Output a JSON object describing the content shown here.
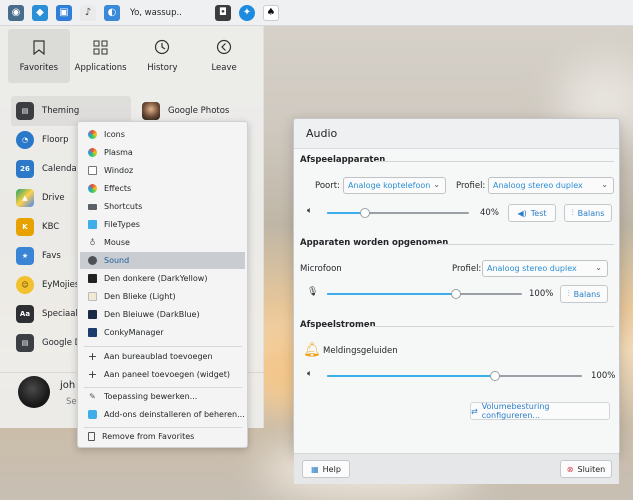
{
  "taskbar": {
    "window_title": "Yo, wassup.."
  },
  "launcher": {
    "tabs": [
      {
        "label": "Favorites",
        "icon": "bookmark-icon"
      },
      {
        "label": "Applications",
        "icon": "grid-icon"
      },
      {
        "label": "History",
        "icon": "clock-icon"
      },
      {
        "label": "Leave",
        "icon": "arrow-left-circle-icon"
      }
    ],
    "favorites_left": [
      {
        "label": "Theming",
        "color": "#3b3d40"
      },
      {
        "label": "Floorp",
        "color": "#2a78c9"
      },
      {
        "label": "Calendar",
        "color": "#2b79c8"
      },
      {
        "label": "Drive",
        "color": "#1fa463"
      },
      {
        "label": "KBC",
        "color": "#e8a200"
      },
      {
        "label": "Favs",
        "color": "#3a84d6"
      },
      {
        "label": "EyMojies",
        "color": "#f2c12e"
      },
      {
        "label": "Speciaal Ş",
        "color": "#2d2f33"
      },
      {
        "label": "Google D",
        "color": "#3c3f44"
      }
    ],
    "favorites_right": [
      {
        "label": "Google Photos"
      }
    ],
    "user_name": "joh",
    "search_placeholder": "Se"
  },
  "context_menu": {
    "items": [
      {
        "label": "Icons",
        "icon": "icons-icon"
      },
      {
        "label": "Plasma",
        "icon": "plasma-icon"
      },
      {
        "label": "Windoz",
        "icon": "window-icon"
      },
      {
        "label": "Effects",
        "icon": "effects-icon"
      },
      {
        "label": "Shortcuts",
        "icon": "keyboard-icon"
      },
      {
        "label": "FileTypes",
        "icon": "filetypes-icon"
      },
      {
        "label": "Mouse",
        "icon": "mouse-icon"
      },
      {
        "label": "Sound",
        "icon": "sound-icon"
      },
      {
        "label": "Den donkere (DarkYellow)",
        "icon": "theme-dark-icon"
      },
      {
        "label": "Den Blieke (Light)",
        "icon": "theme-light-icon"
      },
      {
        "label": "Den Bleiuwe (DarkBlue)",
        "icon": "theme-blue-icon"
      },
      {
        "label": "ConkyManager",
        "icon": "conky-icon"
      }
    ],
    "add_items": [
      {
        "label": "Aan bureaublad toevoegen"
      },
      {
        "label": "Aan paneel toevoegen (widget)"
      }
    ],
    "edit_items": [
      {
        "label": "Toepassing bewerken..."
      },
      {
        "label": "Add-ons deinstalleren of beheren..."
      }
    ],
    "remove_label": "Remove from Favorites"
  },
  "audio": {
    "title": "Audio",
    "playback": {
      "section": "Afspeelapparaten",
      "port_label": "Poort:",
      "port_value": "Analoge koptelefoon",
      "profile_label": "Profiel:",
      "profile_value": "Analoog stereo duplex",
      "volume_pct": "40%",
      "volume_fraction": 0.27,
      "test_label": "Test",
      "balance_label": "Balans"
    },
    "recording": {
      "section": "Apparaten worden opgenomen",
      "device_label": "Microfoon",
      "profile_label": "Profiel:",
      "profile_value": "Analoog stereo duplex",
      "volume_pct": "100%",
      "volume_fraction": 0.66,
      "balance_label": "Balans"
    },
    "streams": {
      "section": "Afspeelstromen",
      "stream_name": "Meldingsgeluiden",
      "volume_pct": "100%",
      "volume_fraction": 0.66
    },
    "configure_label": "Volumebesturing configureren...",
    "help_label": "Help",
    "close_label": "Sluiten"
  }
}
